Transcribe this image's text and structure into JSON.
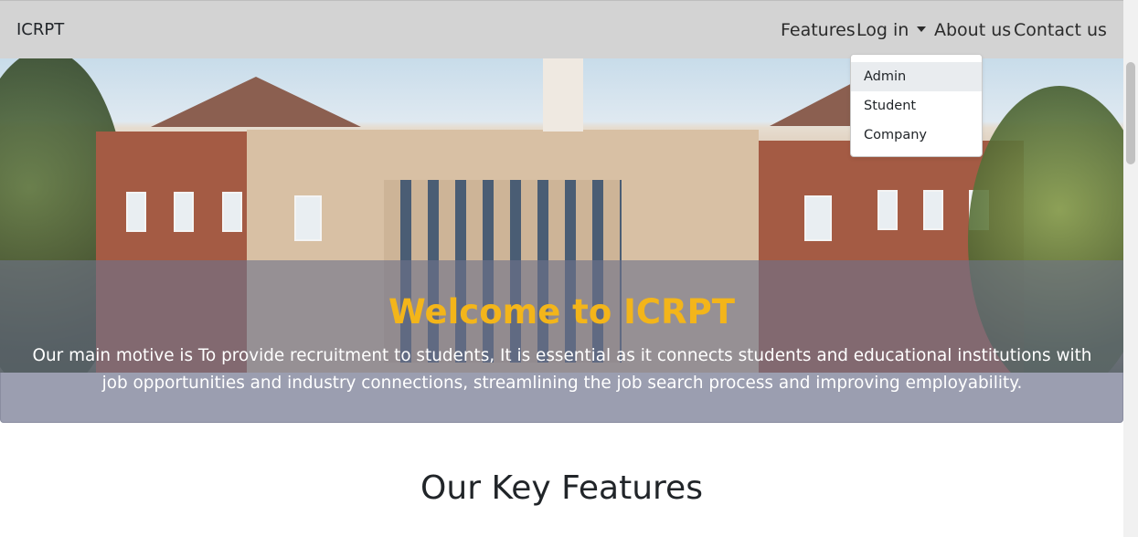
{
  "navbar": {
    "brand": "ICRPT",
    "items": [
      {
        "label": "Features"
      },
      {
        "label": "Log in"
      },
      {
        "label": "About us"
      },
      {
        "label": "Contact us"
      }
    ]
  },
  "login_dropdown": {
    "items": [
      {
        "label": "Admin",
        "highlighted": true
      },
      {
        "label": "Student"
      },
      {
        "label": "Company"
      }
    ]
  },
  "hero": {
    "heading": "Welcome to ICRPT",
    "description": "Our main motive is To provide recruitment to students, It is essential as it connects students and educational institutions with job opportunities and industry connections, streamlining the job search process and improving employability.",
    "heading_color": "#f3b51a"
  },
  "features": {
    "title": "Our Key Features"
  },
  "colors": {
    "navbar_bg": "#d3d3d3",
    "overlay": "#6e728a"
  }
}
